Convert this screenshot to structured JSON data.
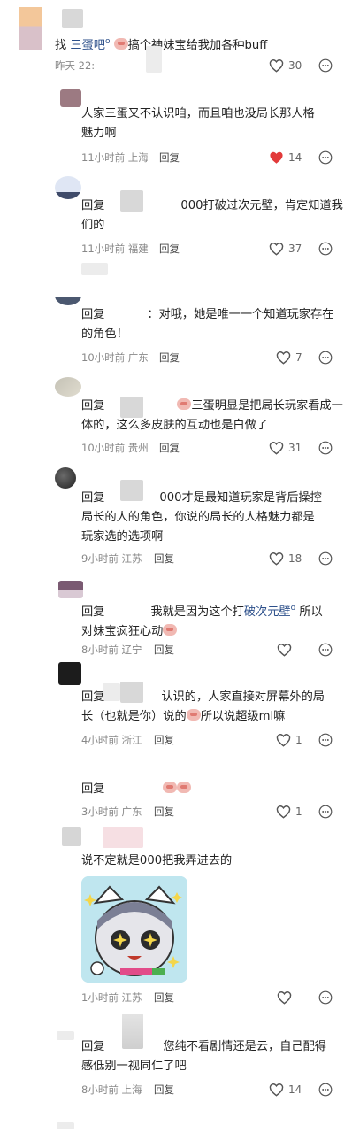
{
  "comments": [
    {
      "text_pre": "找",
      "text_link": "三蛋吧",
      "text_post": "搞个神妹宝给我加各种buff",
      "time": "昨天 22:",
      "location": "",
      "reply_label": "",
      "likes": "30",
      "liked": false
    },
    {
      "text_1": "人家三蛋又不认识咱，而且咱也没局长那人格",
      "text_2": "魅力啊",
      "time": "11小时前",
      "location": "上海",
      "reply_label": "回复",
      "likes": "14",
      "liked": true
    },
    {
      "prefix": "回复",
      "text_1": "000打破过次元壁，肯定知道我",
      "text_2": "们的",
      "time": "11小时前",
      "location": "福建",
      "reply_label": "回复",
      "likes": "37",
      "liked": false
    },
    {
      "prefix": "回复",
      "text_1": "：对哦，她是唯一一个知道玩家存在",
      "text_2": "的角色！",
      "time": "10小时前",
      "location": "广东",
      "reply_label": "回复",
      "likes": "7",
      "liked": false
    },
    {
      "prefix": "回复",
      "text_1": "三蛋明显是把局长玩家看成一",
      "text_2": "体的，这么多皮肤的互动也是白做了",
      "time": "10小时前",
      "location": "贵州",
      "reply_label": "回复",
      "likes": "31",
      "liked": false
    },
    {
      "prefix": "回复",
      "text_1": "000才是最知道玩家是背后操控",
      "text_2": "局长的人的角色，你说的局长的人格魅力都是",
      "text_3": "玩家选的选项啊",
      "time": "9小时前",
      "location": "江苏",
      "reply_label": "回复",
      "likes": "18",
      "liked": false
    },
    {
      "prefix": "回复",
      "text_1": "我就是因为这个打",
      "text_link": "破次元壁",
      "text_post": "所以",
      "text_2": "对妹宝疯狂心动",
      "time": "8小时前",
      "location": "辽宁",
      "reply_label": "回复",
      "likes": "",
      "liked": false
    },
    {
      "prefix": "回复",
      "text_1": "认识的，人家直接对屏幕外的局",
      "text_2": "长（也就是你）说的",
      "text_2b": "所以说超级ml嘛",
      "time": "4小时前",
      "location": "浙江",
      "reply_label": "回复",
      "likes": "1",
      "liked": false
    },
    {
      "prefix": "回复",
      "time": "3小时前",
      "location": "广东",
      "reply_label": "回复",
      "likes": "1",
      "liked": false
    },
    {
      "text_1": "说不定就是000把我弄进去的",
      "time": "1小时前",
      "location": "江苏",
      "reply_label": "回复",
      "likes": "",
      "liked": false
    },
    {
      "prefix": "回复",
      "text_1": "您纯不看剧情还是云，自己配得",
      "text_2": "感低别一视同仁了吧",
      "time": "8小时前",
      "location": "上海",
      "reply_label": "回复",
      "likes": "14",
      "liked": false
    }
  ],
  "colors": {
    "link": "#2c4f8a",
    "liked": "#e23a3a",
    "meta": "#888888"
  },
  "icons": {
    "like": "heart-outline-icon",
    "liked": "heart-filled-icon",
    "more": "more-dots-icon"
  }
}
